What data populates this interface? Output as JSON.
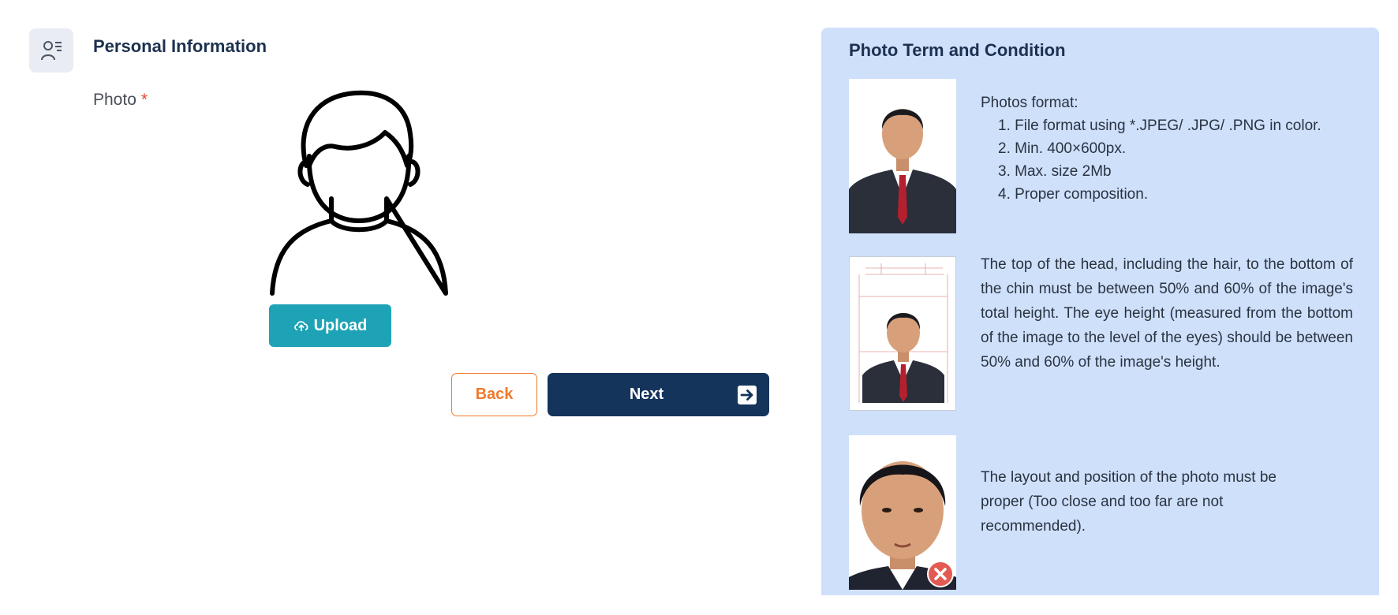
{
  "section": {
    "title": "Personal Information",
    "icon": "user-list-icon"
  },
  "photo": {
    "label": "Photo",
    "required_mark": "*",
    "placeholder_icon": "user-avatar-icon"
  },
  "buttons": {
    "upload": "Upload",
    "back": "Back",
    "next": "Next"
  },
  "panel": {
    "title": "Photo Term and Condition",
    "rules": [
      {
        "heading": "Photos format:",
        "items": [
          "1. File format using *.JPEG/ .JPG/ .PNG in color.",
          "2. Min. 400×600px.",
          "3. Max. size 2Mb",
          "4. Proper composition."
        ]
      },
      {
        "text": "The top of the head, including the hair, to the bottom of the chin must be between 50% and 60% of the image's total height. The eye height (measured from the bottom of the image to the level of the eyes) should be between 50% and 60% of the image's height."
      },
      {
        "text": "The layout and position of the photo must be proper (Too close and too far are not recommended)."
      }
    ]
  },
  "colors": {
    "primary": "#14345c",
    "upload": "#1ea2b6",
    "back": "#f07a2b",
    "panel_bg": "#cfe0fb",
    "required": "#e8412c"
  }
}
